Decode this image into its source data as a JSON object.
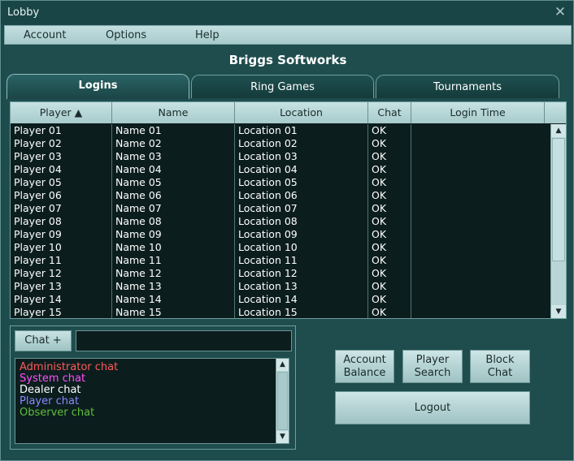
{
  "window": {
    "title": "Lobby",
    "close_glyph": "✕"
  },
  "menu": {
    "items": [
      "Account",
      "Options",
      "Help"
    ]
  },
  "brand": "Briggs Softworks",
  "tabs": [
    {
      "label": "Logins",
      "active": true
    },
    {
      "label": "Ring Games",
      "active": false
    },
    {
      "label": "Tournaments",
      "active": false
    }
  ],
  "table": {
    "columns": [
      "Player ▲",
      "Name",
      "Location",
      "Chat",
      "Login Time"
    ],
    "rows": [
      [
        "Player 01",
        "Name 01",
        "Location 01",
        "OK",
        ""
      ],
      [
        "Player 02",
        "Name 02",
        "Location 02",
        "OK",
        ""
      ],
      [
        "Player 03",
        "Name 03",
        "Location 03",
        "OK",
        ""
      ],
      [
        "Player 04",
        "Name 04",
        "Location 04",
        "OK",
        ""
      ],
      [
        "Player 05",
        "Name 05",
        "Location 05",
        "OK",
        ""
      ],
      [
        "Player 06",
        "Name 06",
        "Location 06",
        "OK",
        ""
      ],
      [
        "Player 07",
        "Name 07",
        "Location 07",
        "OK",
        ""
      ],
      [
        "Player 08",
        "Name 08",
        "Location 08",
        "OK",
        ""
      ],
      [
        "Player 09",
        "Name 09",
        "Location 09",
        "OK",
        ""
      ],
      [
        "Player 10",
        "Name 10",
        "Location 10",
        "OK",
        ""
      ],
      [
        "Player 11",
        "Name 11",
        "Location 11",
        "OK",
        ""
      ],
      [
        "Player 12",
        "Name 12",
        "Location 12",
        "OK",
        ""
      ],
      [
        "Player 13",
        "Name 13",
        "Location 13",
        "OK",
        ""
      ],
      [
        "Player 14",
        "Name 14",
        "Location 14",
        "OK",
        ""
      ],
      [
        "Player 15",
        "Name 15",
        "Location 15",
        "OK",
        ""
      ]
    ]
  },
  "chat": {
    "button_label": "Chat +",
    "input_value": "",
    "lines": [
      {
        "text": "Administrator chat",
        "color": "#ff5a5a"
      },
      {
        "text": "System chat",
        "color": "#ff4fff"
      },
      {
        "text": "Dealer chat",
        "color": "#ffffff"
      },
      {
        "text": "Player chat",
        "color": "#8a8aff"
      },
      {
        "text": "Observer chat",
        "color": "#5fbf3f"
      }
    ]
  },
  "buttons": {
    "account_balance": "Account\nBalance",
    "player_search": "Player\nSearch",
    "block_chat": "Block\nChat",
    "logout": "Logout"
  },
  "colors": {
    "background": "#1f4d4e",
    "grid_background": "#0c1d1d",
    "header": "#b8d7d8"
  }
}
